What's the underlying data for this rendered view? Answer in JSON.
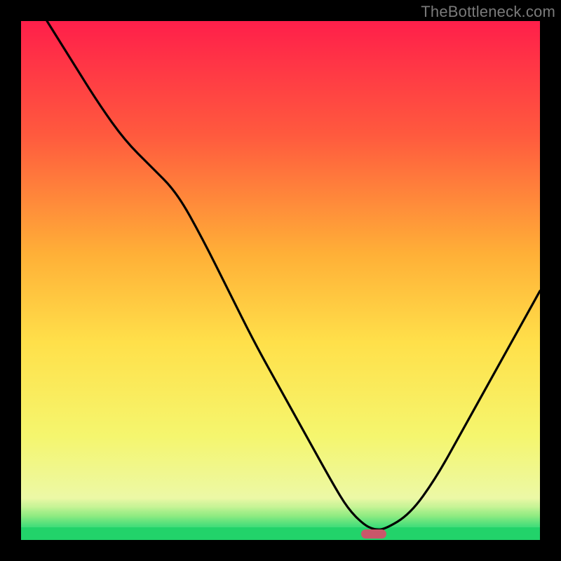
{
  "watermark": "TheBottleneck.com",
  "colors": {
    "frame": "#000000",
    "gradient_top": "#ff1f4a",
    "gradient_mid_upper": "#ff6a3a",
    "gradient_mid": "#ffc535",
    "gradient_mid_lower": "#f7eb4a",
    "gradient_lower": "#f1f89e",
    "green": "#22d36a",
    "curve": "#000000",
    "marker": "#c9576a"
  },
  "chart_data": {
    "type": "line",
    "title": "",
    "xlabel": "",
    "ylabel": "",
    "xlim": [
      0,
      100
    ],
    "ylim": [
      0,
      100
    ],
    "grid": false,
    "legend_position": "none",
    "series": [
      {
        "name": "bottleneck-curve",
        "x": [
          5,
          10,
          15,
          20,
          25,
          30,
          35,
          40,
          45,
          50,
          55,
          60,
          63,
          66,
          68,
          70,
          75,
          80,
          85,
          90,
          95,
          100
        ],
        "values": [
          100,
          92,
          84,
          77,
          72,
          67,
          58,
          48,
          38,
          29,
          20,
          11,
          6,
          3,
          2,
          2,
          5,
          12,
          21,
          30,
          39,
          48
        ]
      }
    ],
    "annotations": [
      {
        "name": "optimal-marker",
        "x": 68,
        "y": 1.2,
        "shape": "pill",
        "color": "#c9576a"
      }
    ],
    "background_gradient": {
      "stops": [
        {
          "pos": 0.0,
          "color": "#ff1f4a"
        },
        {
          "pos": 0.22,
          "color": "#ff5a3e"
        },
        {
          "pos": 0.45,
          "color": "#ffb037"
        },
        {
          "pos": 0.62,
          "color": "#ffe04a"
        },
        {
          "pos": 0.8,
          "color": "#f5f66e"
        },
        {
          "pos": 0.92,
          "color": "#ecf8a6"
        },
        {
          "pos": 0.975,
          "color": "#6fe692"
        },
        {
          "pos": 1.0,
          "color": "#22d36a"
        }
      ]
    }
  }
}
